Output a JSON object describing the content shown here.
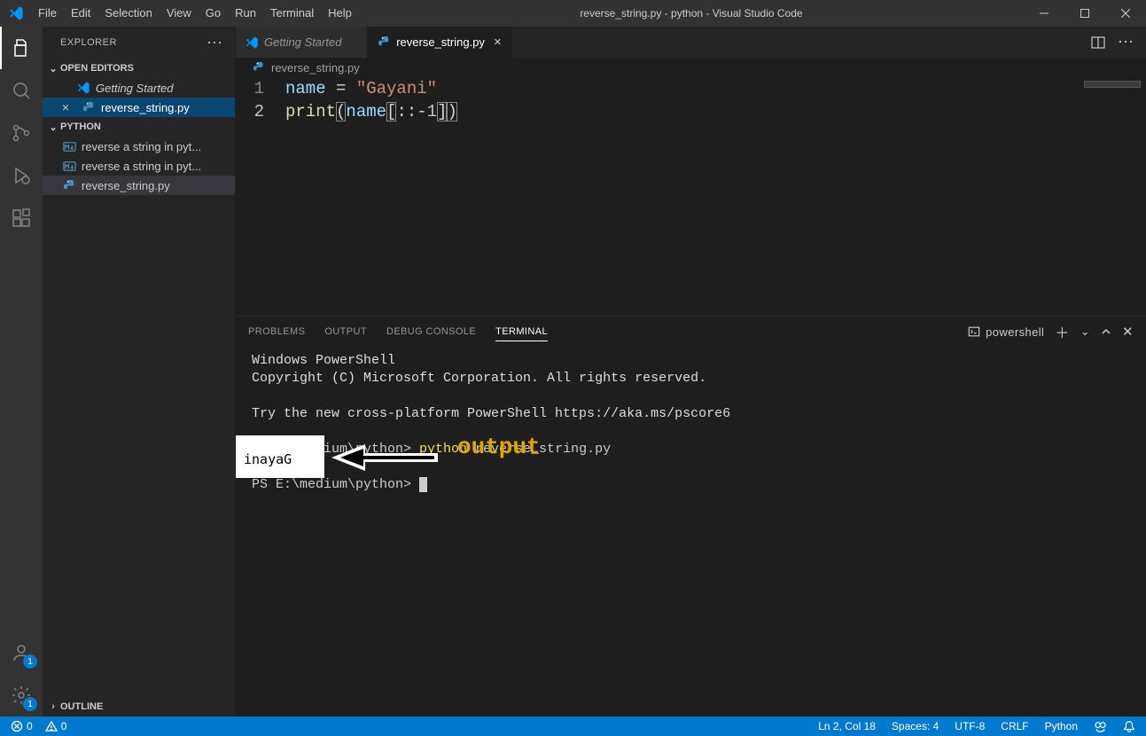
{
  "window": {
    "title": "reverse_string.py - python - Visual Studio Code"
  },
  "menu": [
    "File",
    "Edit",
    "Selection",
    "View",
    "Go",
    "Run",
    "Terminal",
    "Help"
  ],
  "activitybar": {
    "accounts_badge": "1",
    "settings_badge": "1"
  },
  "sidebar": {
    "title": "EXPLORER",
    "sections": {
      "open_editors": {
        "label": "OPEN EDITORS",
        "items": [
          {
            "icon": "vscode",
            "label": "Getting Started",
            "italic": true
          },
          {
            "icon": "python",
            "label": "reverse_string.py",
            "close": true,
            "active": true
          }
        ]
      },
      "folder": {
        "label": "PYTHON",
        "items": [
          {
            "icon": "markdown",
            "label": "reverse a string in pyt..."
          },
          {
            "icon": "markdown",
            "label": "reverse a string in pyt..."
          },
          {
            "icon": "python",
            "label": "reverse_string.py",
            "selected": true
          }
        ]
      },
      "outline": {
        "label": "OUTLINE"
      }
    }
  },
  "tabs": [
    {
      "icon": "vscode",
      "label": "Getting Started",
      "italic": true,
      "active": false
    },
    {
      "icon": "python",
      "label": "reverse_string.py",
      "active": true
    }
  ],
  "breadcrumbs": {
    "icon": "python",
    "label": "reverse_string.py"
  },
  "code": {
    "lines": [
      {
        "n": "1",
        "tokens": [
          {
            "t": "name",
            "c": "var"
          },
          {
            "t": " ",
            "c": "op"
          },
          {
            "t": "=",
            "c": "op"
          },
          {
            "t": " ",
            "c": "op"
          },
          {
            "t": "\"Gayani\"",
            "c": "str"
          }
        ]
      },
      {
        "n": "2",
        "cursor": true,
        "tokens": [
          {
            "t": "print",
            "c": "fn"
          },
          {
            "t": "(",
            "c": "punc",
            "box": true
          },
          {
            "t": "name",
            "c": "var"
          },
          {
            "t": "[",
            "c": "punc",
            "box": true
          },
          {
            "t": "::",
            "c": "op"
          },
          {
            "t": "-",
            "c": "op"
          },
          {
            "t": "1",
            "c": "num"
          },
          {
            "t": "]",
            "c": "punc",
            "box": true
          },
          {
            "t": ")",
            "c": "punc",
            "box": true
          }
        ]
      }
    ]
  },
  "panel": {
    "tabs": [
      "PROBLEMS",
      "OUTPUT",
      "DEBUG CONSOLE",
      "TERMINAL"
    ],
    "active": 3,
    "shell": "powershell",
    "terminal": {
      "lines": [
        "Windows PowerShell",
        "Copyright (C) Microsoft Corporation. All rights reserved.",
        "",
        "Try the new cross-platform PowerShell https://aka.ms/pscore6",
        ""
      ],
      "prompt1_prefix": "PS E:\\medium\\python> ",
      "cmd1": "python",
      "cmd1_args": " reverse_string.py",
      "output": "inayaG",
      "prompt2": "PS E:\\medium\\python> "
    },
    "annotation_label": "output"
  },
  "statusbar": {
    "errors": "0",
    "warnings": "0",
    "right": [
      "Ln 2, Col 18",
      "Spaces: 4",
      "UTF-8",
      "CRLF",
      "Python"
    ]
  }
}
